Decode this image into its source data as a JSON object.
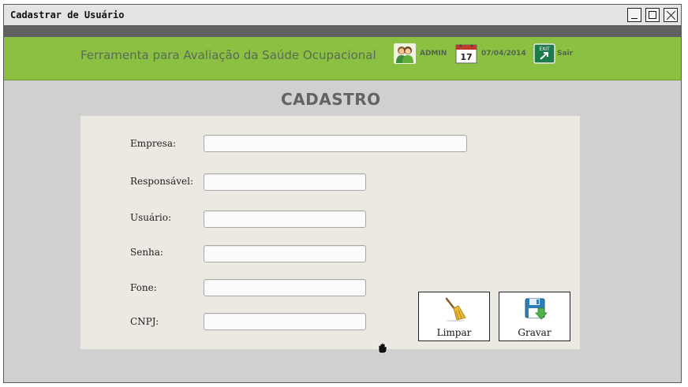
{
  "window": {
    "title": "Cadastrar de Usuário",
    "controls": [
      "minimize-icon",
      "maximize-icon",
      "close-icon"
    ]
  },
  "header": {
    "app_title": "Ferramenta para Avaliação da Saúde Ocupacional",
    "user": "ADMIN",
    "calendar_day": "17",
    "date": "07/04/2014",
    "exit_icon_text": "EXIT",
    "logout": "Sair",
    "icons": [
      "users-icon",
      "calendar-icon",
      "exit-icon"
    ],
    "colors": {
      "bar": "#8bc043",
      "strip": "#616161"
    }
  },
  "form": {
    "title": "CADASTRO",
    "fields": [
      {
        "label": "Empresa:",
        "value": ""
      },
      {
        "label": "Responsável:",
        "value": ""
      },
      {
        "label": "Usuário:",
        "value": ""
      },
      {
        "label": "Senha:",
        "value": ""
      },
      {
        "label": "Fone:",
        "value": ""
      },
      {
        "label": "CNPJ:",
        "value": ""
      }
    ],
    "buttons": {
      "clear": "Limpar",
      "save": "Gravar"
    },
    "button_icons": [
      "broom-icon",
      "floppy-disk-icon"
    ]
  }
}
